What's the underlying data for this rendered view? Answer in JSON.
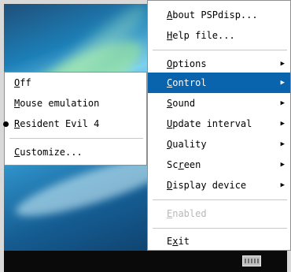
{
  "main_menu": {
    "items": [
      {
        "label": "About PSPdisp...",
        "underline": "A",
        "has_submenu": false
      },
      {
        "label": "Help file...",
        "underline": "H",
        "has_submenu": false
      },
      {
        "label": "Options",
        "underline": "O",
        "has_submenu": true
      },
      {
        "label": "Control",
        "underline": "C",
        "has_submenu": true,
        "highlighted": true
      },
      {
        "label": "Sound",
        "underline": "S",
        "has_submenu": true
      },
      {
        "label": "Update interval",
        "underline": "U",
        "has_submenu": true
      },
      {
        "label": "Quality",
        "underline": "Q",
        "has_submenu": true
      },
      {
        "label": "Screen",
        "underline": "r",
        "has_submenu": true
      },
      {
        "label": "Display device",
        "underline": "D",
        "has_submenu": true
      },
      {
        "label": "Enabled",
        "underline": "E",
        "disabled": true
      },
      {
        "label": "Exit",
        "underline": "x",
        "has_submenu": false
      }
    ]
  },
  "control_submenu": {
    "items": [
      {
        "label": "Off",
        "underline": "O",
        "selected": false
      },
      {
        "label": "Mouse emulation",
        "underline": "M",
        "selected": false
      },
      {
        "label": "Resident Evil 4",
        "underline": "R",
        "selected": true
      },
      {
        "label": "Customize...",
        "underline": "C",
        "selected": false
      }
    ]
  },
  "icons": {
    "submenu_arrow": "arrow-right-icon",
    "radio_bullet": "bullet-icon",
    "tray": "keyboard-icon"
  },
  "colors": {
    "highlight": "#0a64ad",
    "menu_bg": "#ffffff",
    "disabled_text": "#b8b8b8"
  }
}
